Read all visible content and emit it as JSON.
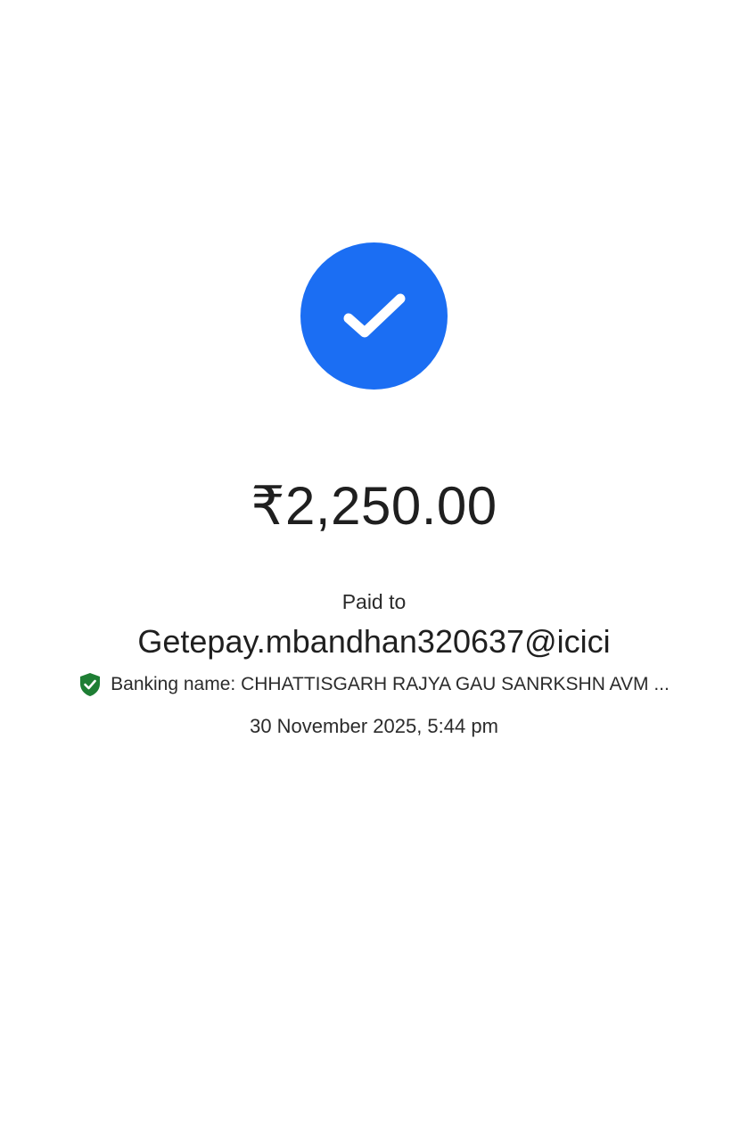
{
  "status": {
    "icon": "checkmark-icon",
    "accent_color": "#1b6ef3"
  },
  "payment": {
    "amount": "₹2,250.00",
    "paid_to_label": "Paid to",
    "payee_upi_id": "Getepay.mbandhan320637@icici",
    "banking_name_label": "Banking name: CHHATTISGARH RAJYA GAU SANRKSHN AVM ...",
    "verified_icon": "verified-shield-icon",
    "verified_color": "#1e7e34",
    "datetime": "30 November 2025, 5:44 pm"
  }
}
